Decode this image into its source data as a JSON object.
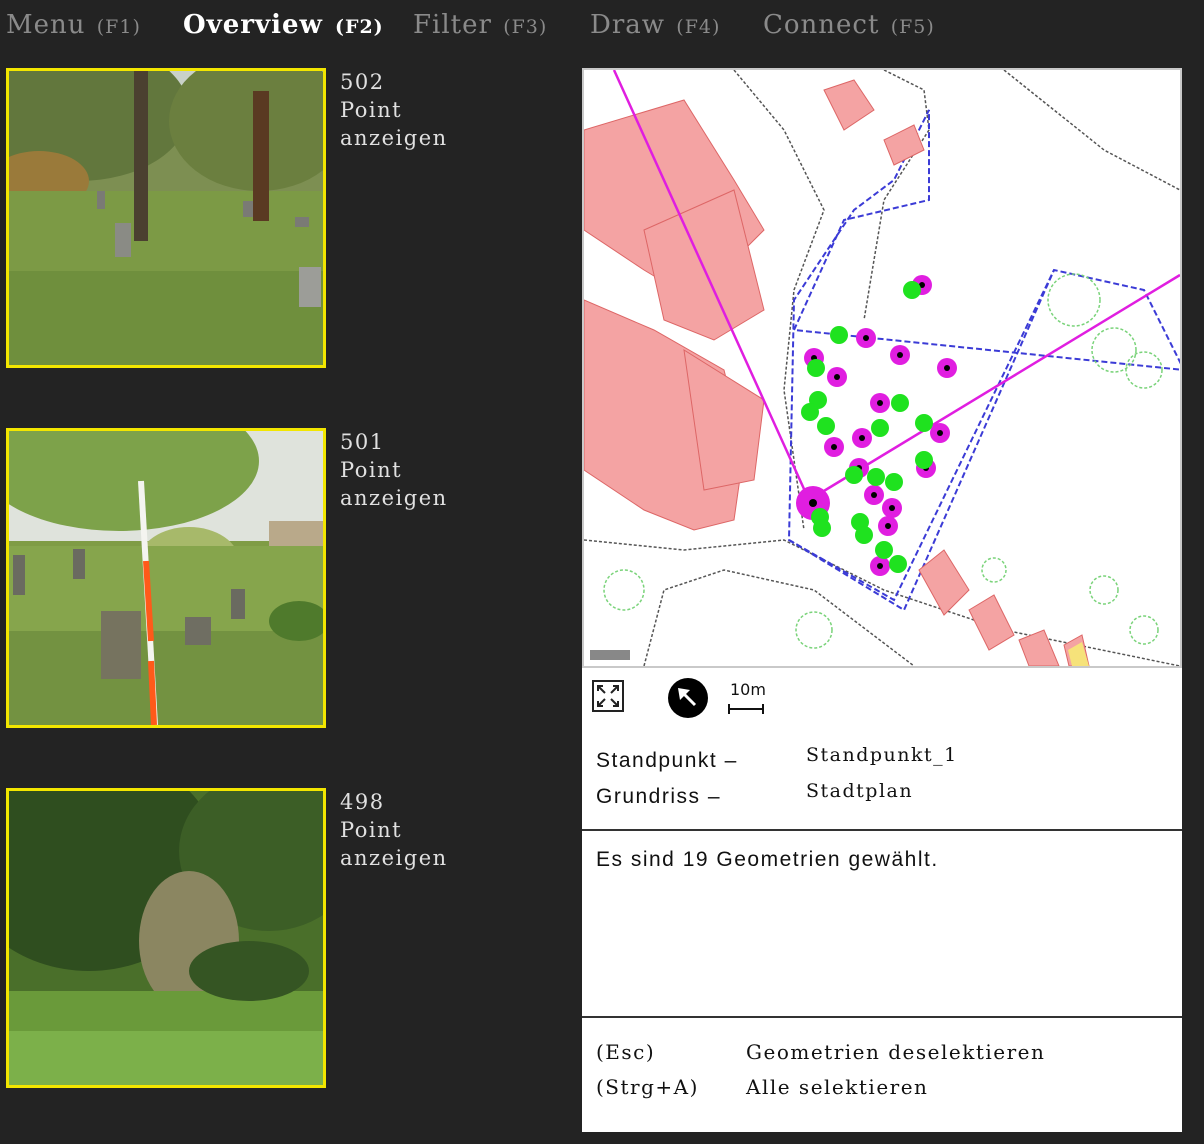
{
  "menu": [
    {
      "label": "Menu",
      "key": "(F1)",
      "active": false
    },
    {
      "label": "Overview",
      "key": "(F2)",
      "active": true
    },
    {
      "label": "Filter",
      "key": "(F3)",
      "active": false
    },
    {
      "label": "Draw",
      "key": "(F4)",
      "active": false
    },
    {
      "label": "Connect",
      "key": "(F5)",
      "active": false
    }
  ],
  "thumbnails": [
    {
      "id": "502",
      "type": "Point",
      "action": "anzeigen"
    },
    {
      "id": "501",
      "type": "Point",
      "action": "anzeigen"
    },
    {
      "id": "498",
      "type": "Point",
      "action": "anzeigen"
    }
  ],
  "map": {
    "scale_label": "10m",
    "icons": {
      "expand": "expand-icon",
      "north": "north-arrow-icon"
    },
    "colors": {
      "buildings": "#f4a3a3",
      "selected": "#e01ee0",
      "points": "#1fe21f",
      "lines": "#3b3bd6"
    }
  },
  "info": {
    "standpunkt_label": "Standpunkt –",
    "standpunkt_value": "Standpunkt_1",
    "grundriss_label": "Grundriss –",
    "grundriss_value": "Stadtplan"
  },
  "selection_message": "Es sind 19 Geometrien gewählt.",
  "shortcuts": [
    {
      "key": "(Esc)",
      "action": "Geometrien deselektieren"
    },
    {
      "key": "(Strg+A)",
      "action": "Alle selektieren"
    }
  ]
}
